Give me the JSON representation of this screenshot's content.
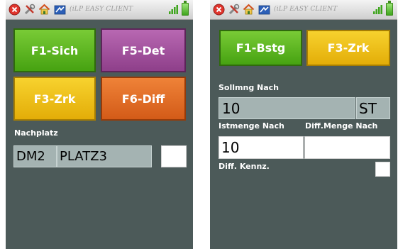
{
  "statusbar": {
    "app_title": "(iLP EASY CLIENT",
    "icons": [
      "close-icon",
      "tools-icon",
      "home-icon",
      "logo-icon",
      "signal-icon",
      "battery-icon"
    ]
  },
  "left_screen": {
    "buttons": {
      "f1": "F1-Sich",
      "f5": "F5-Det",
      "f3": "F3-Zrk",
      "f6": "F6-Diff"
    },
    "nachplatz_label": "Nachplatz",
    "nachplatz_lager": "DM2",
    "nachplatz_platz": "PLATZ3",
    "nachplatz_extra": ""
  },
  "right_screen": {
    "buttons": {
      "f1": "F1-Bstg",
      "f3": "F3-Zrk"
    },
    "sollmenge_label": "Sollmng Nach",
    "sollmenge_value": "10",
    "sollmenge_unit": "ST",
    "istmenge_label": "Istmenge Nach",
    "diffmenge_label": "Diff.Menge Nach",
    "istmenge_value": "10",
    "diffmenge_value": "",
    "diff_kennz_label": "Diff. Kennz.",
    "diff_kennz_checked": false
  },
  "colors": {
    "background": "#4c5a59",
    "green_button": "#5bb521",
    "purple_button": "#a553a0",
    "yellow_button": "#f0c21a",
    "orange_button": "#e36f27",
    "readonly_field": "#a4b3b2"
  }
}
